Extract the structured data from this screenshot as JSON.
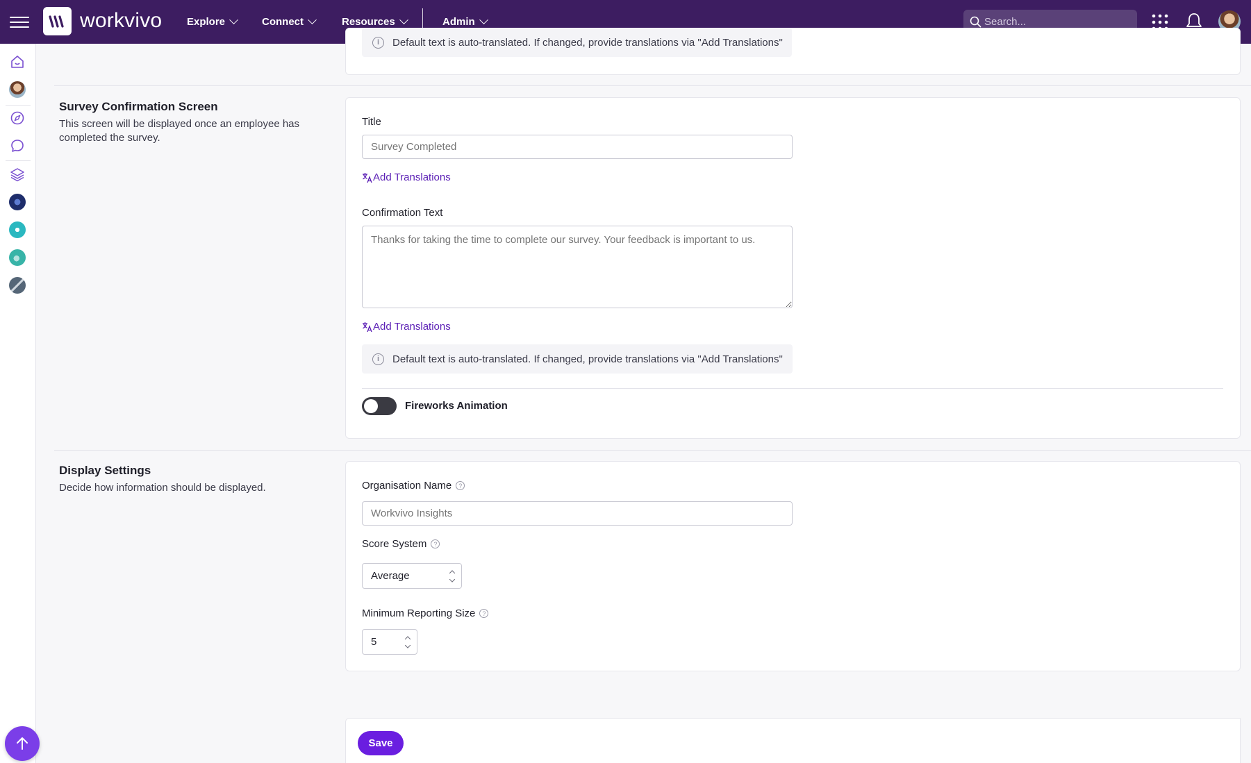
{
  "topbar": {
    "brand": "workvivo",
    "nav": [
      {
        "label": "Explore"
      },
      {
        "label": "Connect"
      },
      {
        "label": "Resources"
      },
      {
        "label": "Admin"
      }
    ],
    "search_placeholder": "Search..."
  },
  "previous_section": {
    "info_text": "Default text is auto-translated. If changed, provide translations via \"Add Translations\""
  },
  "confirmation_section": {
    "title": "Survey Confirmation Screen",
    "description": "This screen will be displayed once an employee has completed the survey.",
    "title_label": "Title",
    "title_placeholder": "Survey Completed",
    "add_translations_1": "Add Translations",
    "confirmation_label": "Confirmation Text",
    "confirmation_placeholder": "Thanks for taking the time to complete our survey. Your feedback is important to us.",
    "add_translations_2": "Add Translations",
    "info_text": "Default text is auto-translated. If changed, provide translations via \"Add Translations\"",
    "fireworks_label": "Fireworks Animation",
    "fireworks_on": false
  },
  "display_section": {
    "title": "Display Settings",
    "description": "Decide how information should be displayed.",
    "org_label": "Organisation Name",
    "org_placeholder": "Workvivo Insights",
    "score_label": "Score System",
    "score_value": "Average",
    "min_label": "Minimum Reporting Size",
    "min_value": "5"
  },
  "footer": {
    "save_label": "Save"
  },
  "colors": {
    "topbar": "#3d1d61",
    "accent": "#6a1ee0",
    "link": "#5b1fb5"
  }
}
